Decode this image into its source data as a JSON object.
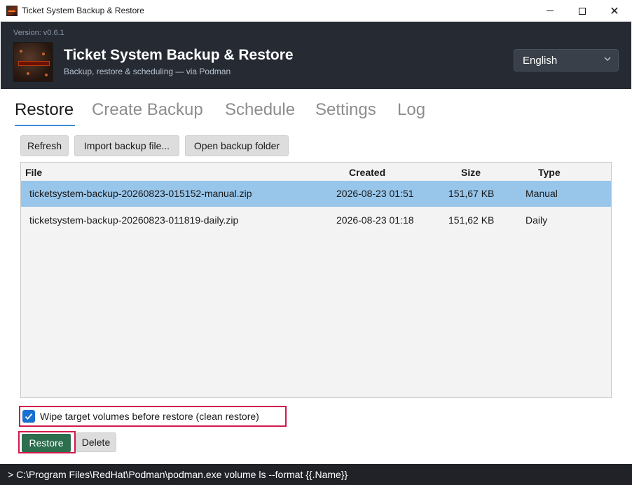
{
  "window": {
    "title": "Ticket System Backup & Restore",
    "minimize_glyph": "",
    "maximize_glyph": "",
    "close_glyph": "✕"
  },
  "header": {
    "version": "Version: v0.6.1",
    "title": "Ticket System Backup & Restore",
    "subtitle": "Backup, restore & scheduling — via Podman",
    "language": "English",
    "background_color": "#262b33"
  },
  "tabs": [
    {
      "label": "Restore",
      "active": true
    },
    {
      "label": "Create Backup",
      "active": false
    },
    {
      "label": "Schedule",
      "active": false
    },
    {
      "label": "Settings",
      "active": false
    },
    {
      "label": "Log",
      "active": false
    }
  ],
  "toolbar": {
    "refresh": "Refresh",
    "import": "Import backup file...",
    "open_folder": "Open backup folder"
  },
  "table": {
    "columns": [
      "File",
      "Created",
      "Size",
      "Type"
    ],
    "rows": [
      {
        "file": "ticketsystem-backup-20260823-015152-manual.zip",
        "created": "2026-08-23 01:51",
        "size": "151,67 KB",
        "type": "Manual",
        "selected": true
      },
      {
        "file": "ticketsystem-backup-20260823-011819-daily.zip",
        "created": "2026-08-23 01:18",
        "size": "151,62 KB",
        "type": "Daily",
        "selected": false
      }
    ],
    "selected_color": "#98c5ea"
  },
  "options": {
    "wipe_label": "Wipe target volumes before restore (clean restore)",
    "wipe_checked": true
  },
  "actions": {
    "restore": "Restore",
    "delete": "Delete",
    "restore_color": "#2c6e4e",
    "highlight_color": "#d11a4c"
  },
  "status": {
    "text": "> C:\\Program Files\\RedHat\\Podman\\podman.exe volume ls --format {{.Name}}"
  }
}
